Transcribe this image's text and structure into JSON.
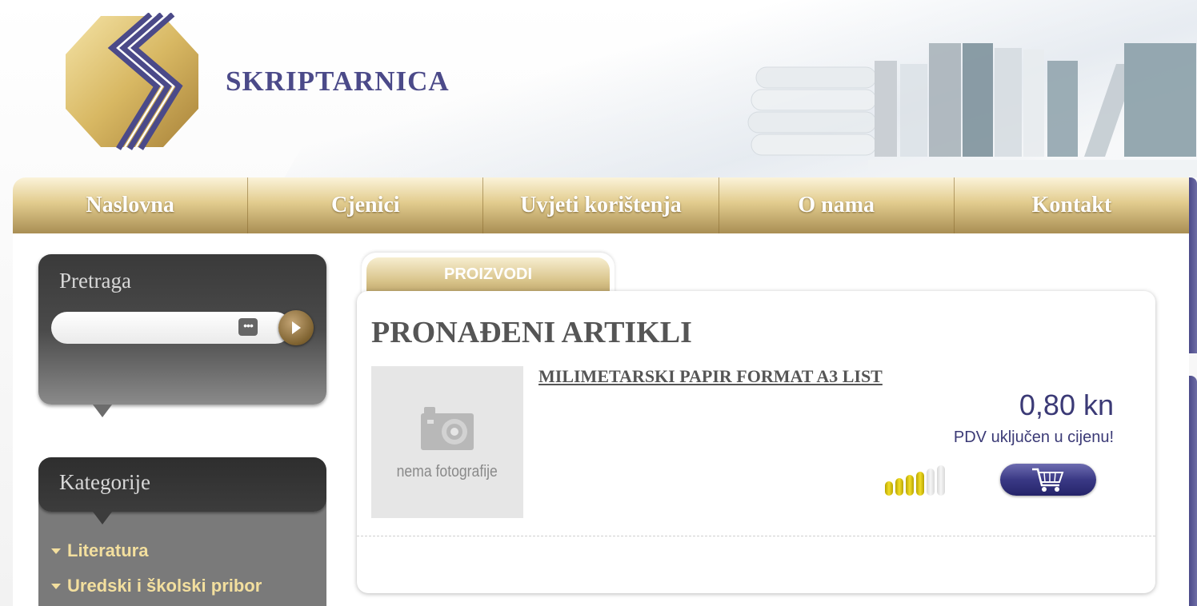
{
  "header": {
    "brand": "SKRIPTARNICA",
    "logo_icon": "skriptarnica-logo-icon",
    "decoration": "books-illustration"
  },
  "nav": {
    "items": [
      {
        "label": "Naslovna"
      },
      {
        "label": "Cjenici"
      },
      {
        "label": "Uvjeti korištenja"
      },
      {
        "label": "O nama"
      },
      {
        "label": "Kontakt"
      }
    ]
  },
  "sidebar": {
    "search": {
      "title": "Pretraga",
      "value": "",
      "go_icon": "play-arrow-icon",
      "options_icon": "ellipsis-icon"
    },
    "categories": {
      "title": "Kategorije",
      "items": [
        {
          "label": "Literatura"
        },
        {
          "label": "Uredski i školski pribor"
        }
      ]
    }
  },
  "main": {
    "tab": "PROIZVODI",
    "heading": "PRONAĐENI ARTIKLI",
    "products": [
      {
        "name": "MILIMETARSKI PAPIR FORMAT A3 LIST",
        "image_placeholder": "nema fotografije",
        "price": "0,80 kn",
        "vat_note": "PDV uključen u cijenu!",
        "stock_level": 4,
        "stock_max": 6,
        "cart_icon": "shopping-cart-icon"
      }
    ]
  },
  "colors": {
    "brand_purple": "#4b4a89",
    "gold": "#d8c389",
    "price_blue": "#3b3a76",
    "category_text": "#f3df9e"
  }
}
